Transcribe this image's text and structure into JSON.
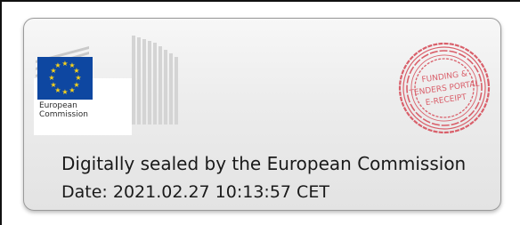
{
  "receipt": {
    "logo": {
      "org_line1": "European",
      "org_line2": "Commission",
      "icon": "eu-flag-building-logo"
    },
    "stamp": {
      "line1": "FUNDING &",
      "line2": "TENDERS PORTAL",
      "line3": "E-RECEIPT",
      "color": "#d95f6a"
    },
    "sealed_by": "Digitally sealed by the European Commission",
    "date": "Date: 2021.02.27 10:13:57 CET"
  },
  "colors": {
    "flag_blue": "#0e47a1",
    "star_yellow": "#f7d21b",
    "text": "#1a1a1a"
  }
}
